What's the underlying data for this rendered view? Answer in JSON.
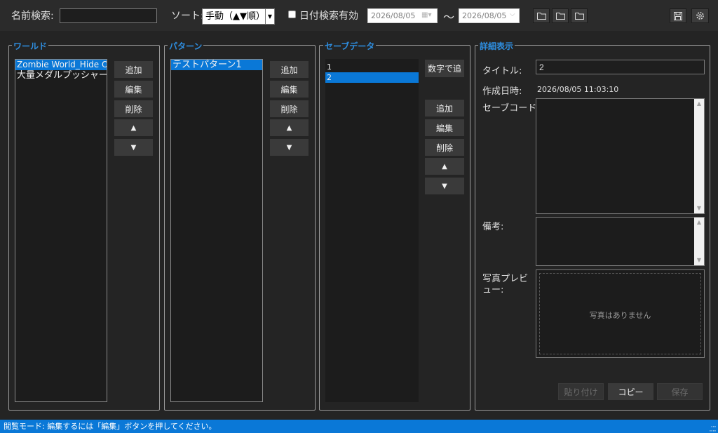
{
  "toolbar": {
    "name_search_label": "名前検索:",
    "name_search_value": "",
    "sort_label": "ソート:",
    "sort_selected": "手動（▲▼順）",
    "date_filter_label": "日付検索有効",
    "date_filter_checked": false,
    "date_from": "2026/08/05",
    "date_tilde": "〜",
    "date_to": "2026/08/05",
    "folder_icons": [
      "folder-icon",
      "folder-icon",
      "folder-icon"
    ],
    "save_icon": "floppy-disk-icon",
    "settings_icon": "gear-icon"
  },
  "world_group": {
    "title": "ワールド",
    "items": [
      "Zombie World_Hide Out",
      "大量メダルプッシャー／ク"
    ],
    "selected_index": 0,
    "buttons": {
      "add": "追加",
      "edit": "編集",
      "delete": "削除",
      "up": "▲",
      "down": "▼"
    }
  },
  "pattern_group": {
    "title": "パターン",
    "items": [
      "テストパターン1"
    ],
    "selected_index": 0,
    "buttons": {
      "add": "追加",
      "edit": "編集",
      "delete": "削除",
      "up": "▲",
      "down": "▼"
    }
  },
  "save_group": {
    "title": "セーブデータ",
    "items": [
      "1",
      "2"
    ],
    "selected_index": 1,
    "buttons": {
      "number_add": "数字で追",
      "add": "追加",
      "edit": "編集",
      "delete": "削除",
      "up": "▲",
      "down": "▼"
    }
  },
  "detail_group": {
    "title": "詳細表示",
    "title_label": "タイトル:",
    "title_value": "2",
    "created_label": "作成日時:",
    "created_value": "2026/08/05 11:03:10",
    "save_code_label": "セーブコード:",
    "notes_label": "備考:",
    "photo_label_line1": "写真プレビ",
    "photo_label_line2": "ュー:",
    "no_photo_text": "写真はありません",
    "paste_label": "貼り付け",
    "copy_label": "コピー",
    "save_label": "保存"
  },
  "status": {
    "text": "閲覧モード: 編集するには「編集」ボタンを押してください。"
  },
  "colors": {
    "accent": "#0a78d7",
    "group_title": "#2e8ee0",
    "background": "#242424"
  }
}
